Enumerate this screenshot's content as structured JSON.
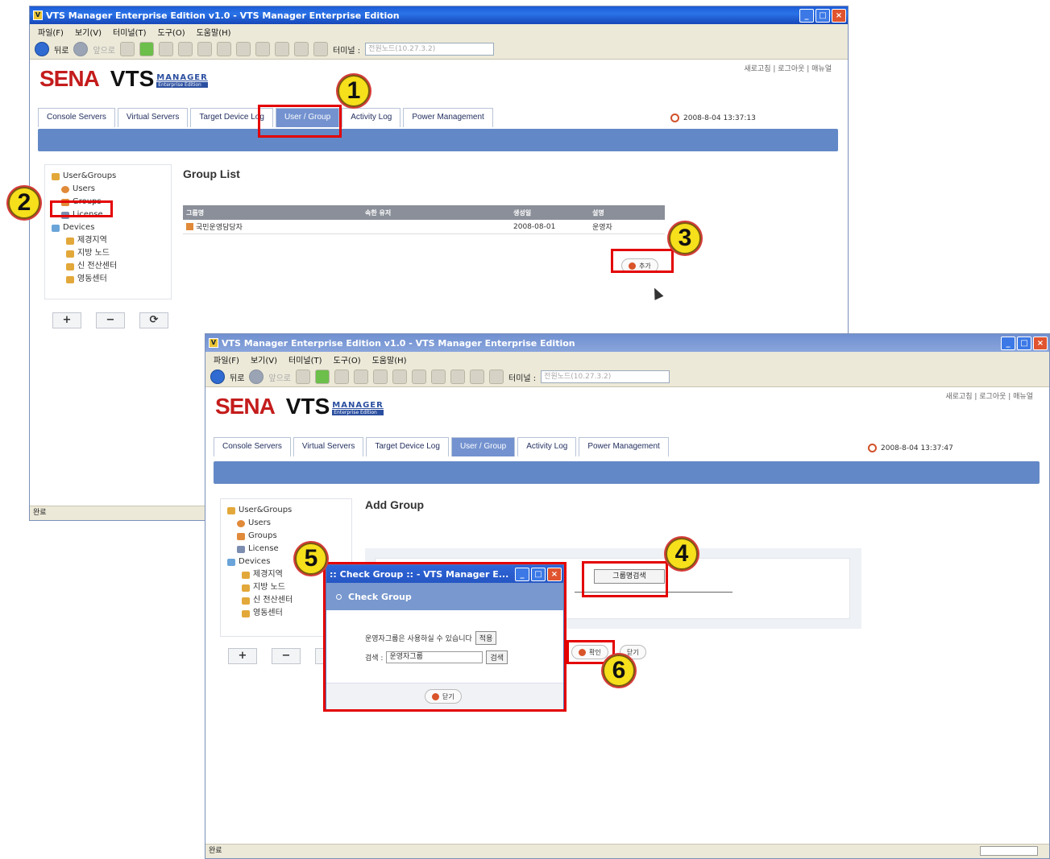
{
  "window": {
    "title": "VTS Manager Enterprise Edition v1.0 - VTS Manager Enterprise Edition",
    "menu": [
      "파일(F)",
      "보기(V)",
      "터미널(T)",
      "도구(O)",
      "도움말(H)"
    ],
    "toolbar": {
      "back_label": "뒤로",
      "forward_label": "앞으로",
      "terminal_label": "터미널 :",
      "address_value": "전원노드(10.27.3.2)"
    },
    "status": "완료"
  },
  "app": {
    "brand": "SENA",
    "product": "VTS",
    "product_sub": "MANAGER",
    "edition": "Enterprise Edition",
    "top_links": "새로고침 | 로그아웃 | 매뉴얼",
    "tabs": [
      "Console Servers",
      "Virtual Servers",
      "Target Device Log",
      "User / Group",
      "Activity Log",
      "Power Management"
    ]
  },
  "back_window": {
    "datetime": "2008-8-04 13:37:13",
    "tree": {
      "root": "User&Groups",
      "items": [
        "Users",
        "Groups",
        "License",
        "Devices",
        "제경지역",
        "지방 노드",
        "신 전산센터",
        "영동센터"
      ]
    },
    "heading": "Group List",
    "table": {
      "headers": [
        "그룹명",
        "속한 유저",
        "생성일",
        "설명"
      ],
      "rows": [
        [
          "국민운영담당자",
          "",
          "2008-08-01",
          "운영자"
        ]
      ]
    },
    "add_button": "추가"
  },
  "front_window": {
    "datetime": "2008-8-04 13:37:47",
    "heading": "Add Group",
    "group_search_button": "그룹명검색",
    "confirm_button": "확인",
    "cancel_button": "닫기"
  },
  "dialog": {
    "title": ":: Check Group :: - VTS Manager E...",
    "header": "Check Group",
    "message": "운영자그룹은 사용하실 수 있습니다",
    "apply_button": "적용",
    "search_label": "검색 :",
    "search_value": "운영자그룹",
    "search_button": "검색",
    "close_button": "닫기"
  },
  "side_buttons": [
    "+",
    "−",
    "⟳"
  ],
  "callouts": [
    "1",
    "2",
    "3",
    "4",
    "5",
    "6"
  ]
}
